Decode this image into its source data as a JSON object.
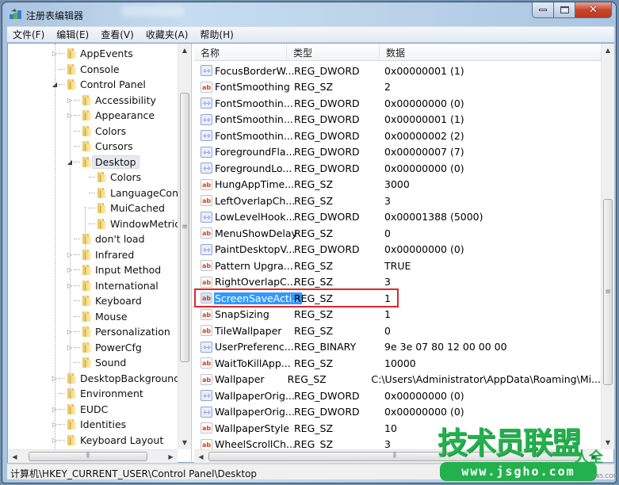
{
  "window": {
    "title": "注册表编辑器",
    "buttons": {
      "minimize": "minimize",
      "maximize": "maximize",
      "close": "✕"
    }
  },
  "menu": [
    "文件(F)",
    "编辑(E)",
    "查看(V)",
    "收藏夹(A)",
    "帮助(H)"
  ],
  "tree": [
    {
      "label": "AppEvents",
      "level": 0,
      "expander": "collapsed"
    },
    {
      "label": "Console",
      "level": 0,
      "expander": "none"
    },
    {
      "label": "Control Panel",
      "level": 0,
      "expander": "expanded"
    },
    {
      "label": "Accessibility",
      "level": 1,
      "expander": "collapsed"
    },
    {
      "label": "Appearance",
      "level": 1,
      "expander": "collapsed"
    },
    {
      "label": "Colors",
      "level": 1,
      "expander": "none"
    },
    {
      "label": "Cursors",
      "level": 1,
      "expander": "none"
    },
    {
      "label": "Desktop",
      "level": 1,
      "expander": "expanded",
      "selected": true
    },
    {
      "label": "Colors",
      "level": 2,
      "expander": "none"
    },
    {
      "label": "LanguageConfig",
      "level": 2,
      "expander": "none"
    },
    {
      "label": "MuiCached",
      "level": 2,
      "expander": "none"
    },
    {
      "label": "WindowMetrics",
      "level": 2,
      "expander": "none"
    },
    {
      "label": "don't load",
      "level": 1,
      "expander": "none"
    },
    {
      "label": "Infrared",
      "level": 1,
      "expander": "collapsed"
    },
    {
      "label": "Input Method",
      "level": 1,
      "expander": "collapsed"
    },
    {
      "label": "International",
      "level": 1,
      "expander": "collapsed"
    },
    {
      "label": "Keyboard",
      "level": 1,
      "expander": "none"
    },
    {
      "label": "Mouse",
      "level": 1,
      "expander": "none"
    },
    {
      "label": "Personalization",
      "level": 1,
      "expander": "collapsed"
    },
    {
      "label": "PowerCfg",
      "level": 1,
      "expander": "collapsed"
    },
    {
      "label": "Sound",
      "level": 1,
      "expander": "none"
    },
    {
      "label": "DesktopBackground",
      "level": 0,
      "expander": "collapsed"
    },
    {
      "label": "Environment",
      "level": 0,
      "expander": "none"
    },
    {
      "label": "EUDC",
      "level": 0,
      "expander": "collapsed"
    },
    {
      "label": "Identities",
      "level": 0,
      "expander": "collapsed"
    },
    {
      "label": "Keyboard Layout",
      "level": 0,
      "expander": "collapsed"
    }
  ],
  "columns": {
    "name": "名称",
    "type": "类型",
    "data": "数据"
  },
  "values": [
    {
      "name": "FocusBorderW...",
      "type": "REG_DWORD",
      "data": "0x00000001 (1)",
      "icon": "binary-value-icon"
    },
    {
      "name": "FontSmoothing",
      "type": "REG_SZ",
      "data": "2",
      "icon": "string-value-icon"
    },
    {
      "name": "FontSmoothin...",
      "type": "REG_DWORD",
      "data": "0x00000000 (0)",
      "icon": "binary-value-icon"
    },
    {
      "name": "FontSmoothin...",
      "type": "REG_DWORD",
      "data": "0x00000001 (1)",
      "icon": "binary-value-icon"
    },
    {
      "name": "FontSmoothin...",
      "type": "REG_DWORD",
      "data": "0x00000002 (2)",
      "icon": "binary-value-icon"
    },
    {
      "name": "ForegroundFla...",
      "type": "REG_DWORD",
      "data": "0x00000007 (7)",
      "icon": "binary-value-icon"
    },
    {
      "name": "ForegroundLo...",
      "type": "REG_DWORD",
      "data": "0x00000000 (0)",
      "icon": "binary-value-icon"
    },
    {
      "name": "HungAppTime...",
      "type": "REG_SZ",
      "data": "3000",
      "icon": "string-value-icon"
    },
    {
      "name": "LeftOverlapCh...",
      "type": "REG_SZ",
      "data": "3",
      "icon": "string-value-icon"
    },
    {
      "name": "LowLevelHook...",
      "type": "REG_DWORD",
      "data": "0x00001388 (5000)",
      "icon": "binary-value-icon"
    },
    {
      "name": "MenuShowDelay",
      "type": "REG_SZ",
      "data": "0",
      "icon": "string-value-icon"
    },
    {
      "name": "PaintDesktopV...",
      "type": "REG_DWORD",
      "data": "0x00000000 (0)",
      "icon": "binary-value-icon"
    },
    {
      "name": "Pattern Upgra...",
      "type": "REG_SZ",
      "data": "TRUE",
      "icon": "string-value-icon"
    },
    {
      "name": "RightOverlapC...",
      "type": "REG_SZ",
      "data": "3",
      "icon": "string-value-icon"
    },
    {
      "name": "ScreenSaveActi...",
      "type": "REG_SZ",
      "data": "1",
      "icon": "string-value-icon",
      "selected": true,
      "highlighted": true
    },
    {
      "name": "SnapSizing",
      "type": "REG_SZ",
      "data": "1",
      "icon": "string-value-icon"
    },
    {
      "name": "TileWallpaper",
      "type": "REG_SZ",
      "data": "0",
      "icon": "string-value-icon"
    },
    {
      "name": "UserPreferenc...",
      "type": "REG_BINARY",
      "data": "9e 3e 07 80 12 00 00 00",
      "icon": "binary-value-icon"
    },
    {
      "name": "WaitToKillApp...",
      "type": "REG_SZ",
      "data": "10000",
      "icon": "string-value-icon"
    },
    {
      "name": "Wallpaper",
      "type": "REG_SZ",
      "data": "C:\\Users\\Administrator\\AppData\\Roaming\\Mi...",
      "icon": "string-value-icon"
    },
    {
      "name": "WallpaperOrig...",
      "type": "REG_DWORD",
      "data": "0x00000000 (0)",
      "icon": "binary-value-icon"
    },
    {
      "name": "WallpaperOrig...",
      "type": "REG_DWORD",
      "data": "0x00000000 (0)",
      "icon": "binary-value-icon"
    },
    {
      "name": "WallpaperStyle",
      "type": "REG_SZ",
      "data": "10",
      "icon": "string-value-icon"
    },
    {
      "name": "WheelScrollCh...",
      "type": "REG_SZ",
      "data": "3",
      "icon": "string-value-icon"
    }
  ],
  "icons": {
    "string": "ab",
    "binary": "011\n110"
  },
  "status_path": "计算机\\HKEY_CURRENT_USER\\Control Panel\\Desktop",
  "watermark": {
    "title": "技术员联盟",
    "url": "www.jsgho.com",
    "sub": "人全",
    "small": "P85.COM"
  },
  "colors": {
    "selection": "#3399ff",
    "highlight_box": "#e1262b",
    "watermark_green": "#22b14c"
  }
}
